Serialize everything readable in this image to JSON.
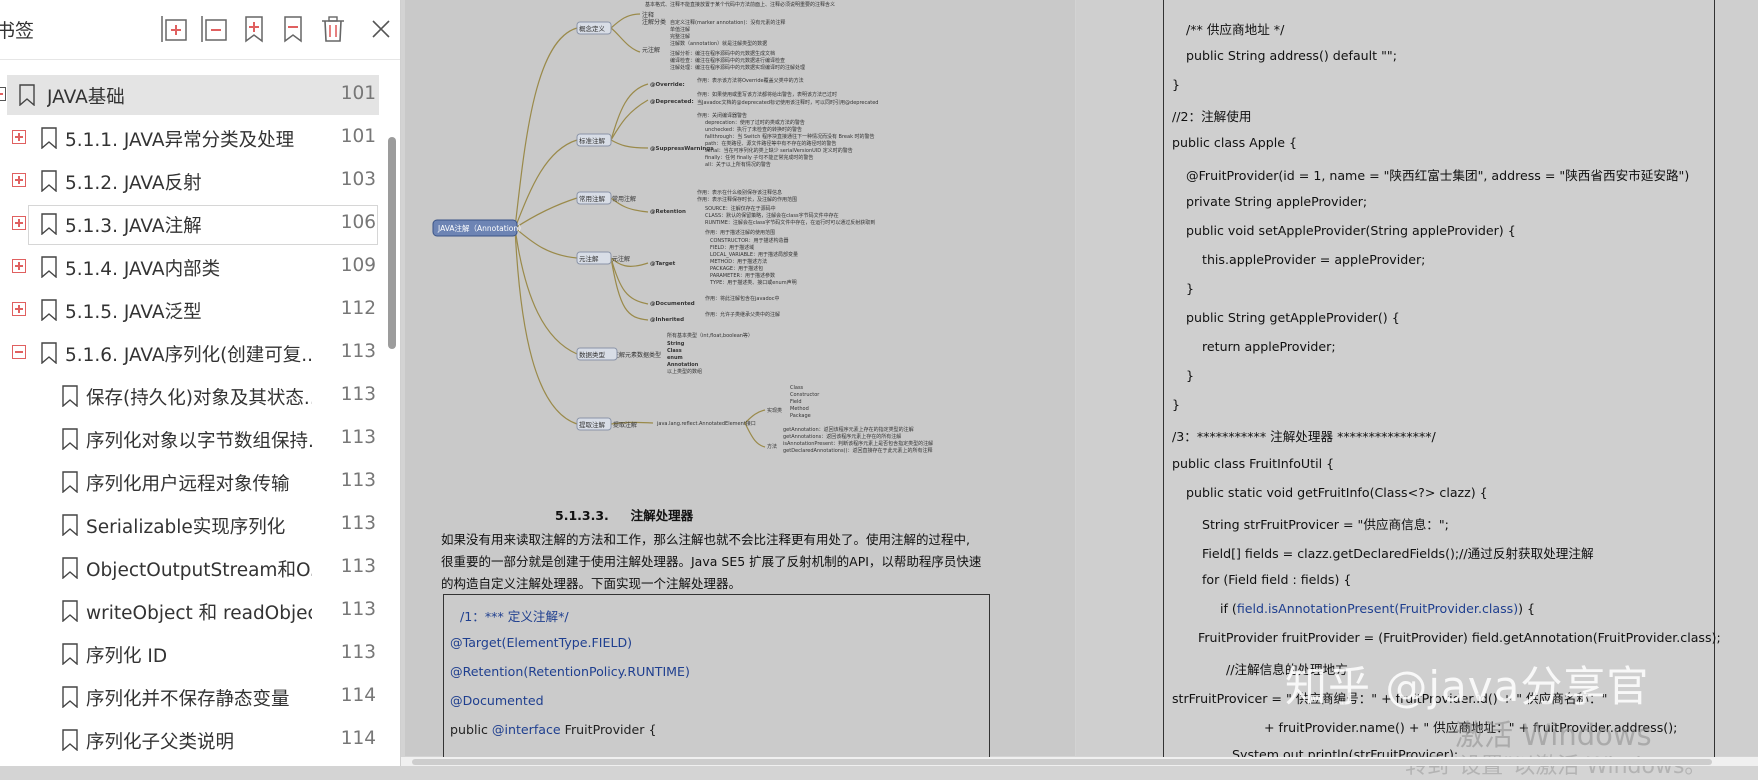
{
  "sidebar": {
    "title": "书签",
    "toolbar": [
      {
        "name": "expand-all-icon"
      },
      {
        "name": "collapse-all-icon"
      },
      {
        "name": "add-bookmark-icon"
      },
      {
        "name": "remove-bookmark-icon"
      },
      {
        "name": "delete-icon"
      },
      {
        "name": "close-icon"
      }
    ],
    "items": [
      {
        "label": "JAVA基础",
        "page": "101",
        "level": 0,
        "toggle": "none",
        "state": "selected"
      },
      {
        "label": "5.1.1. JAVA异常分类及处理",
        "page": "101",
        "level": 1,
        "toggle": "plus",
        "state": ""
      },
      {
        "label": "5.1.2. JAVA反射",
        "page": "103",
        "level": 1,
        "toggle": "plus",
        "state": ""
      },
      {
        "label": "5.1.3. JAVA注解",
        "page": "106",
        "level": 1,
        "toggle": "plus",
        "state": "hovered"
      },
      {
        "label": "5.1.4. JAVA内部类",
        "page": "109",
        "level": 1,
        "toggle": "plus",
        "state": ""
      },
      {
        "label": "5.1.5. JAVA泛型",
        "page": "112",
        "level": 1,
        "toggle": "plus",
        "state": ""
      },
      {
        "label": "5.1.6. JAVA序列化(创建可复...",
        "page": "113",
        "level": 1,
        "toggle": "minus",
        "state": ""
      },
      {
        "label": "保存(持久化)对象及其状态...",
        "page": "113",
        "level": 2,
        "toggle": "none",
        "state": ""
      },
      {
        "label": "序列化对象以字节数组保持...",
        "page": "113",
        "level": 2,
        "toggle": "none",
        "state": ""
      },
      {
        "label": "序列化用户远程对象传输",
        "page": "113",
        "level": 2,
        "toggle": "none",
        "state": ""
      },
      {
        "label": "Serializable实现序列化",
        "page": "113",
        "level": 2,
        "toggle": "none",
        "state": ""
      },
      {
        "label": "ObjectOutputStream和O...",
        "page": "113",
        "level": 2,
        "toggle": "none",
        "state": ""
      },
      {
        "label": "writeObject 和 readObjec...",
        "page": "113",
        "level": 2,
        "toggle": "none",
        "state": ""
      },
      {
        "label": "序列化 ID",
        "page": "113",
        "level": 2,
        "toggle": "none",
        "state": ""
      },
      {
        "label": "序列化并不保存静态变量",
        "page": "114",
        "level": 2,
        "toggle": "none",
        "state": ""
      },
      {
        "label": "序列化子父类说明",
        "page": "114",
        "level": 2,
        "toggle": "none",
        "state": ""
      }
    ]
  },
  "document": {
    "left_page": {
      "mindmap": {
        "root": "JAVA注解（Annotation）",
        "branches": [
          "概念定义",
          "标准注解",
          "元注解",
          "注解元素数据类型",
          "提取注解"
        ],
        "sub_labels": [
          "@Override",
          "@Deprecated",
          "@SuppressWarnings",
          "@Retention",
          "@Target",
          "@Documented",
          "@Inherited"
        ],
        "notes": [
          "String",
          "Class",
          "enum",
          "Annotation",
          "java.lang.reflect.AnnotatedElement接口"
        ]
      },
      "section_number": "5.1.3.3.",
      "section_title": "注解处理器",
      "paragraph": [
        "如果没有用来读取注解的方法和工作，那么注解也就不会比注释更有用处了。使用注解的过程中,",
        "很重要的一部分就是创建于使用注解处理器。Java SE5 扩展了反射机制的API，以帮助程序员快速",
        "的构造自定义注解处理器。下面实现一个注解处理器。"
      ],
      "code": [
        {
          "text": "/1：*** 定义注解*/",
          "style": "blue",
          "indent": 10
        },
        {
          "text": "@Target(ElementType.FIELD)",
          "style": "blue",
          "indent": 0
        },
        {
          "text": "@Retention(RetentionPolicy.RUNTIME)",
          "style": "blue",
          "indent": 0
        },
        {
          "text": "@Documented",
          "style": "blue",
          "indent": 0
        },
        {
          "text": "public @interface FruitProvider {",
          "style": "mixed",
          "indent": 0
        }
      ]
    },
    "right_page": {
      "lines": [
        {
          "text": "/** 供应商地址 */",
          "style": "plain",
          "indent": 14
        },
        {
          "text": "public String address() default \"\";",
          "style": "plain",
          "indent": 14
        },
        {
          "text": "}",
          "style": "plain",
          "indent": 0
        },
        {
          "text": "//2：注解使用",
          "style": "blue",
          "indent": 0
        },
        {
          "text": "public class Apple {",
          "style": "plain",
          "indent": 0
        },
        {
          "text": "@FruitProvider(id = 1, name = \"陕西红富士集团\", address = \"陕西省西安市延安路\")",
          "style": "blue",
          "indent": 14
        },
        {
          "text": "private String appleProvider;",
          "style": "plain",
          "indent": 14
        },
        {
          "text": "public void setAppleProvider(String appleProvider) {",
          "style": "plain",
          "indent": 14
        },
        {
          "text": "this.appleProvider = appleProvider;",
          "style": "plain",
          "indent": 30
        },
        {
          "text": "}",
          "style": "plain",
          "indent": 14
        },
        {
          "text": "public String getAppleProvider() {",
          "style": "plain",
          "indent": 14
        },
        {
          "text": "return appleProvider;",
          "style": "plain",
          "indent": 30
        },
        {
          "text": "}",
          "style": "plain",
          "indent": 14
        },
        {
          "text": "}",
          "style": "plain",
          "indent": 0
        },
        {
          "text": "/3：*********** 注解处理器 ***************/",
          "style": "red",
          "indent": 0
        },
        {
          "text": "public class FruitInfoUtil {",
          "style": "plain",
          "indent": 0
        },
        {
          "text": "public static void getFruitInfo(Class<?> clazz) {",
          "style": "plain",
          "indent": 14
        },
        {
          "text": "String strFruitProvicer = \"供应商信息：\";",
          "style": "plain",
          "indent": 30
        },
        {
          "text": "Field[] fields = clazz.getDeclaredFields();//通过反射获取处理注解",
          "style": "blue",
          "indent": 30
        },
        {
          "text": "for (Field field : fields) {",
          "style": "plain",
          "indent": 30
        },
        {
          "text": "if (field.isAnnotationPresent(FruitProvider.class)) {",
          "style": "mixed",
          "indent": 48
        },
        {
          "text": "FruitProvider fruitProvider = (FruitProvider) field.getAnnotation(FruitProvider.class);",
          "style": "blue",
          "indent": 26
        },
        {
          "text": "//注解信息的处理地方",
          "style": "blue",
          "indent": 54
        },
        {
          "text": "strFruitProvicer = \" 供应商编号：\" + fruitProvider.id() + \" 供应商名称：\"",
          "style": "plain",
          "indent": 0
        },
        {
          "text": "+ fruitProvider.name() + \" 供应商地址：\" + fruitProvider.address();",
          "style": "plain",
          "indent": 92
        },
        {
          "text": "System.out.println(strFruitProvicer);",
          "style": "plain",
          "indent": 60
        }
      ]
    },
    "watermark": "知乎 @java分享官",
    "windows_activation": [
      "激活 Windows",
      "转到\"设置\"以激活 Windows。"
    ]
  }
}
